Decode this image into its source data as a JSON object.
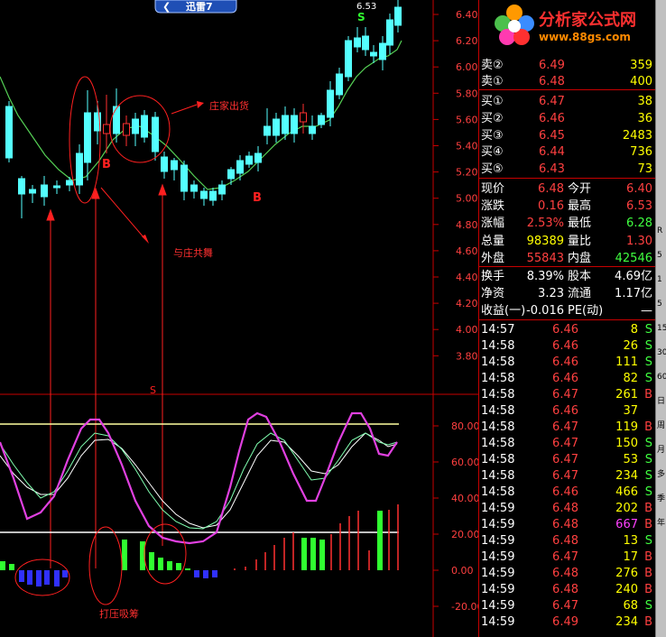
{
  "tab": {
    "label": "迅雷7"
  },
  "logo": {
    "name": "分析家公式网",
    "url": "www.88gs.com"
  },
  "price_axis": [
    "6.40",
    "6.20",
    "6.00",
    "5.80",
    "5.60",
    "5.40",
    "5.20",
    "5.00",
    "4.80",
    "4.60",
    "4.40",
    "4.20",
    "4.00",
    "3.80"
  ],
  "ind_axis": [
    "80.00",
    "60.00",
    "40.00",
    "20.00",
    "0.00",
    "-20.00"
  ],
  "annotations": {
    "zhuangjia": "庄家出货",
    "yuzhuang": "与庄共舞",
    "daya": "打压吸筹",
    "b1": "B",
    "b2": "B",
    "s1": "S",
    "s2": "S",
    "high": "6.53"
  },
  "sell_orders": [
    {
      "label": "卖②",
      "price": "6.49",
      "vol": "359"
    },
    {
      "label": "卖①",
      "price": "6.48",
      "vol": "400"
    }
  ],
  "buy_orders": [
    {
      "label": "买①",
      "price": "6.47",
      "vol": "38"
    },
    {
      "label": "买②",
      "price": "6.46",
      "vol": "36"
    },
    {
      "label": "买③",
      "price": "6.45",
      "vol": "2483"
    },
    {
      "label": "买④",
      "price": "6.44",
      "vol": "736"
    },
    {
      "label": "买⑤",
      "price": "6.43",
      "vol": "73"
    }
  ],
  "stats": [
    {
      "l1": "现价",
      "v1": "6.48",
      "l2": "今开",
      "v2": "6.40",
      "c1": "up",
      "c2": "up"
    },
    {
      "l1": "涨跌",
      "v1": "0.16",
      "l2": "最高",
      "v2": "6.53",
      "c1": "up",
      "c2": "up"
    },
    {
      "l1": "涨幅",
      "v1": "2.53%",
      "l2": "最低",
      "v2": "6.28",
      "c1": "up",
      "c2": "down"
    },
    {
      "l1": "总量",
      "v1": "98389",
      "l2": "量比",
      "v2": "1.30",
      "c1": "yel",
      "c2": "up"
    },
    {
      "l1": "外盘",
      "v1": "55843",
      "l2": "内盘",
      "v2": "42546",
      "c1": "up",
      "c2": "down"
    }
  ],
  "stats2": [
    {
      "l1": "换手",
      "v1": "8.39%",
      "l2": "股本",
      "v2": "4.69亿"
    },
    {
      "l1": "净资",
      "v1": "3.23",
      "l2": "流通",
      "v2": "1.17亿"
    },
    {
      "l1": "收益(一)",
      "v1": "-0.016",
      "l2": "PE(动)",
      "v2": "—"
    }
  ],
  "ticks": [
    {
      "time": "14:57",
      "price": "6.46",
      "vol": "8",
      "side": "S",
      "pc": "up",
      "vc": "yel"
    },
    {
      "time": "14:58",
      "price": "6.46",
      "vol": "26",
      "side": "S",
      "pc": "up",
      "vc": "yel"
    },
    {
      "time": "14:58",
      "price": "6.46",
      "vol": "111",
      "side": "S",
      "pc": "up",
      "vc": "yel"
    },
    {
      "time": "14:58",
      "price": "6.46",
      "vol": "82",
      "side": "S",
      "pc": "up",
      "vc": "yel"
    },
    {
      "time": "14:58",
      "price": "6.47",
      "vol": "261",
      "side": "B",
      "pc": "up",
      "vc": "yel"
    },
    {
      "time": "14:58",
      "price": "6.46",
      "vol": "37",
      "side": "",
      "pc": "up",
      "vc": "yel"
    },
    {
      "time": "14:58",
      "price": "6.47",
      "vol": "119",
      "side": "B",
      "pc": "up",
      "vc": "yel"
    },
    {
      "time": "14:58",
      "price": "6.47",
      "vol": "150",
      "side": "S",
      "pc": "up",
      "vc": "yel"
    },
    {
      "time": "14:58",
      "price": "6.47",
      "vol": "53",
      "side": "S",
      "pc": "up",
      "vc": "yel"
    },
    {
      "time": "14:58",
      "price": "6.47",
      "vol": "234",
      "side": "S",
      "pc": "up",
      "vc": "yel"
    },
    {
      "time": "14:58",
      "price": "6.46",
      "vol": "466",
      "side": "S",
      "pc": "up",
      "vc": "yel"
    },
    {
      "time": "14:59",
      "price": "6.48",
      "vol": "202",
      "side": "B",
      "pc": "up",
      "vc": "yel"
    },
    {
      "time": "14:59",
      "price": "6.48",
      "vol": "667",
      "side": "B",
      "pc": "up",
      "vc": "mag"
    },
    {
      "time": "14:59",
      "price": "6.48",
      "vol": "13",
      "side": "S",
      "pc": "up",
      "vc": "yel"
    },
    {
      "time": "14:59",
      "price": "6.47",
      "vol": "17",
      "side": "B",
      "pc": "up",
      "vc": "yel"
    },
    {
      "time": "14:59",
      "price": "6.48",
      "vol": "276",
      "side": "B",
      "pc": "up",
      "vc": "yel"
    },
    {
      "time": "14:59",
      "price": "6.48",
      "vol": "240",
      "side": "B",
      "pc": "up",
      "vc": "yel"
    },
    {
      "time": "14:59",
      "price": "6.47",
      "vol": "68",
      "side": "S",
      "pc": "up",
      "vc": "yel"
    },
    {
      "time": "14:59",
      "price": "6.49",
      "vol": "234",
      "side": "B",
      "pc": "up",
      "vc": "yel"
    }
  ],
  "right_edge": [
    "R",
    "5",
    "1",
    "5",
    "15",
    "30",
    "60",
    "日",
    "周",
    "月",
    "多",
    "季",
    "年"
  ]
}
